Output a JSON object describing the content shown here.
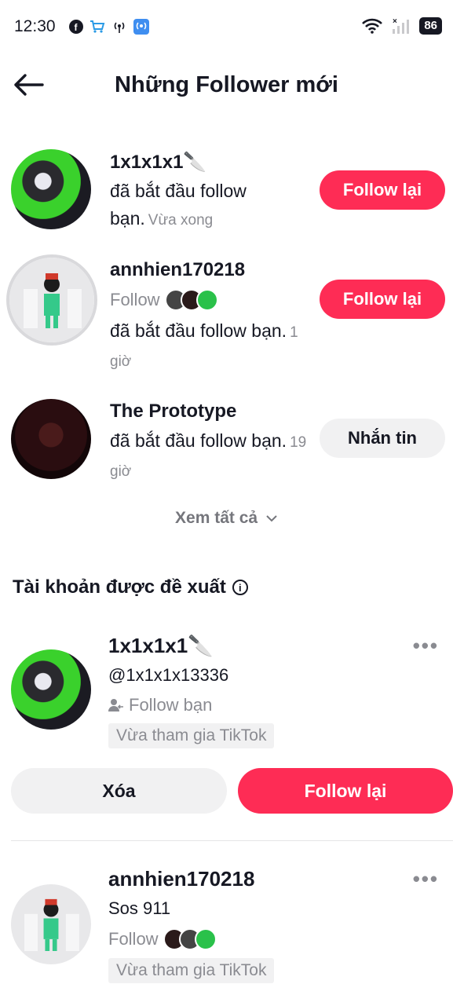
{
  "status": {
    "time": "12:30",
    "battery": "86"
  },
  "header": {
    "title": "Những Follower mới"
  },
  "notifications": [
    {
      "name": "1x1x1x1🔪",
      "text": "đã bắt đầu follow bạn.",
      "time": "Vừa xong",
      "button": "Follow lại"
    },
    {
      "name": "annhien170218",
      "followed_by": "Follow",
      "text": "đã bắt đầu follow bạn.",
      "time": "1 giờ",
      "button": "Follow lại"
    },
    {
      "name": "The Prototype",
      "text": "đã bắt đầu follow bạn.",
      "time": "19 giờ",
      "button": "Nhắn tin"
    }
  ],
  "see_all": "Xem tất cả",
  "suggested": {
    "title": "Tài khoản được đề xuất",
    "items": [
      {
        "name": "1x1x1x1🔪",
        "sub": "@1x1x1x13336",
        "follow_text": "Follow bạn",
        "tag": "Vừa tham gia TikTok",
        "remove": "Xóa",
        "follow_back": "Follow lại"
      },
      {
        "name": "annhien170218",
        "sub": "Sos 911",
        "follow_text": "Follow",
        "tag": "Vừa tham gia TikTok"
      }
    ]
  },
  "colors": {
    "accent": "#fe2c55",
    "secondary_button": "#f1f1f2",
    "muted_text": "#8a8b91"
  }
}
